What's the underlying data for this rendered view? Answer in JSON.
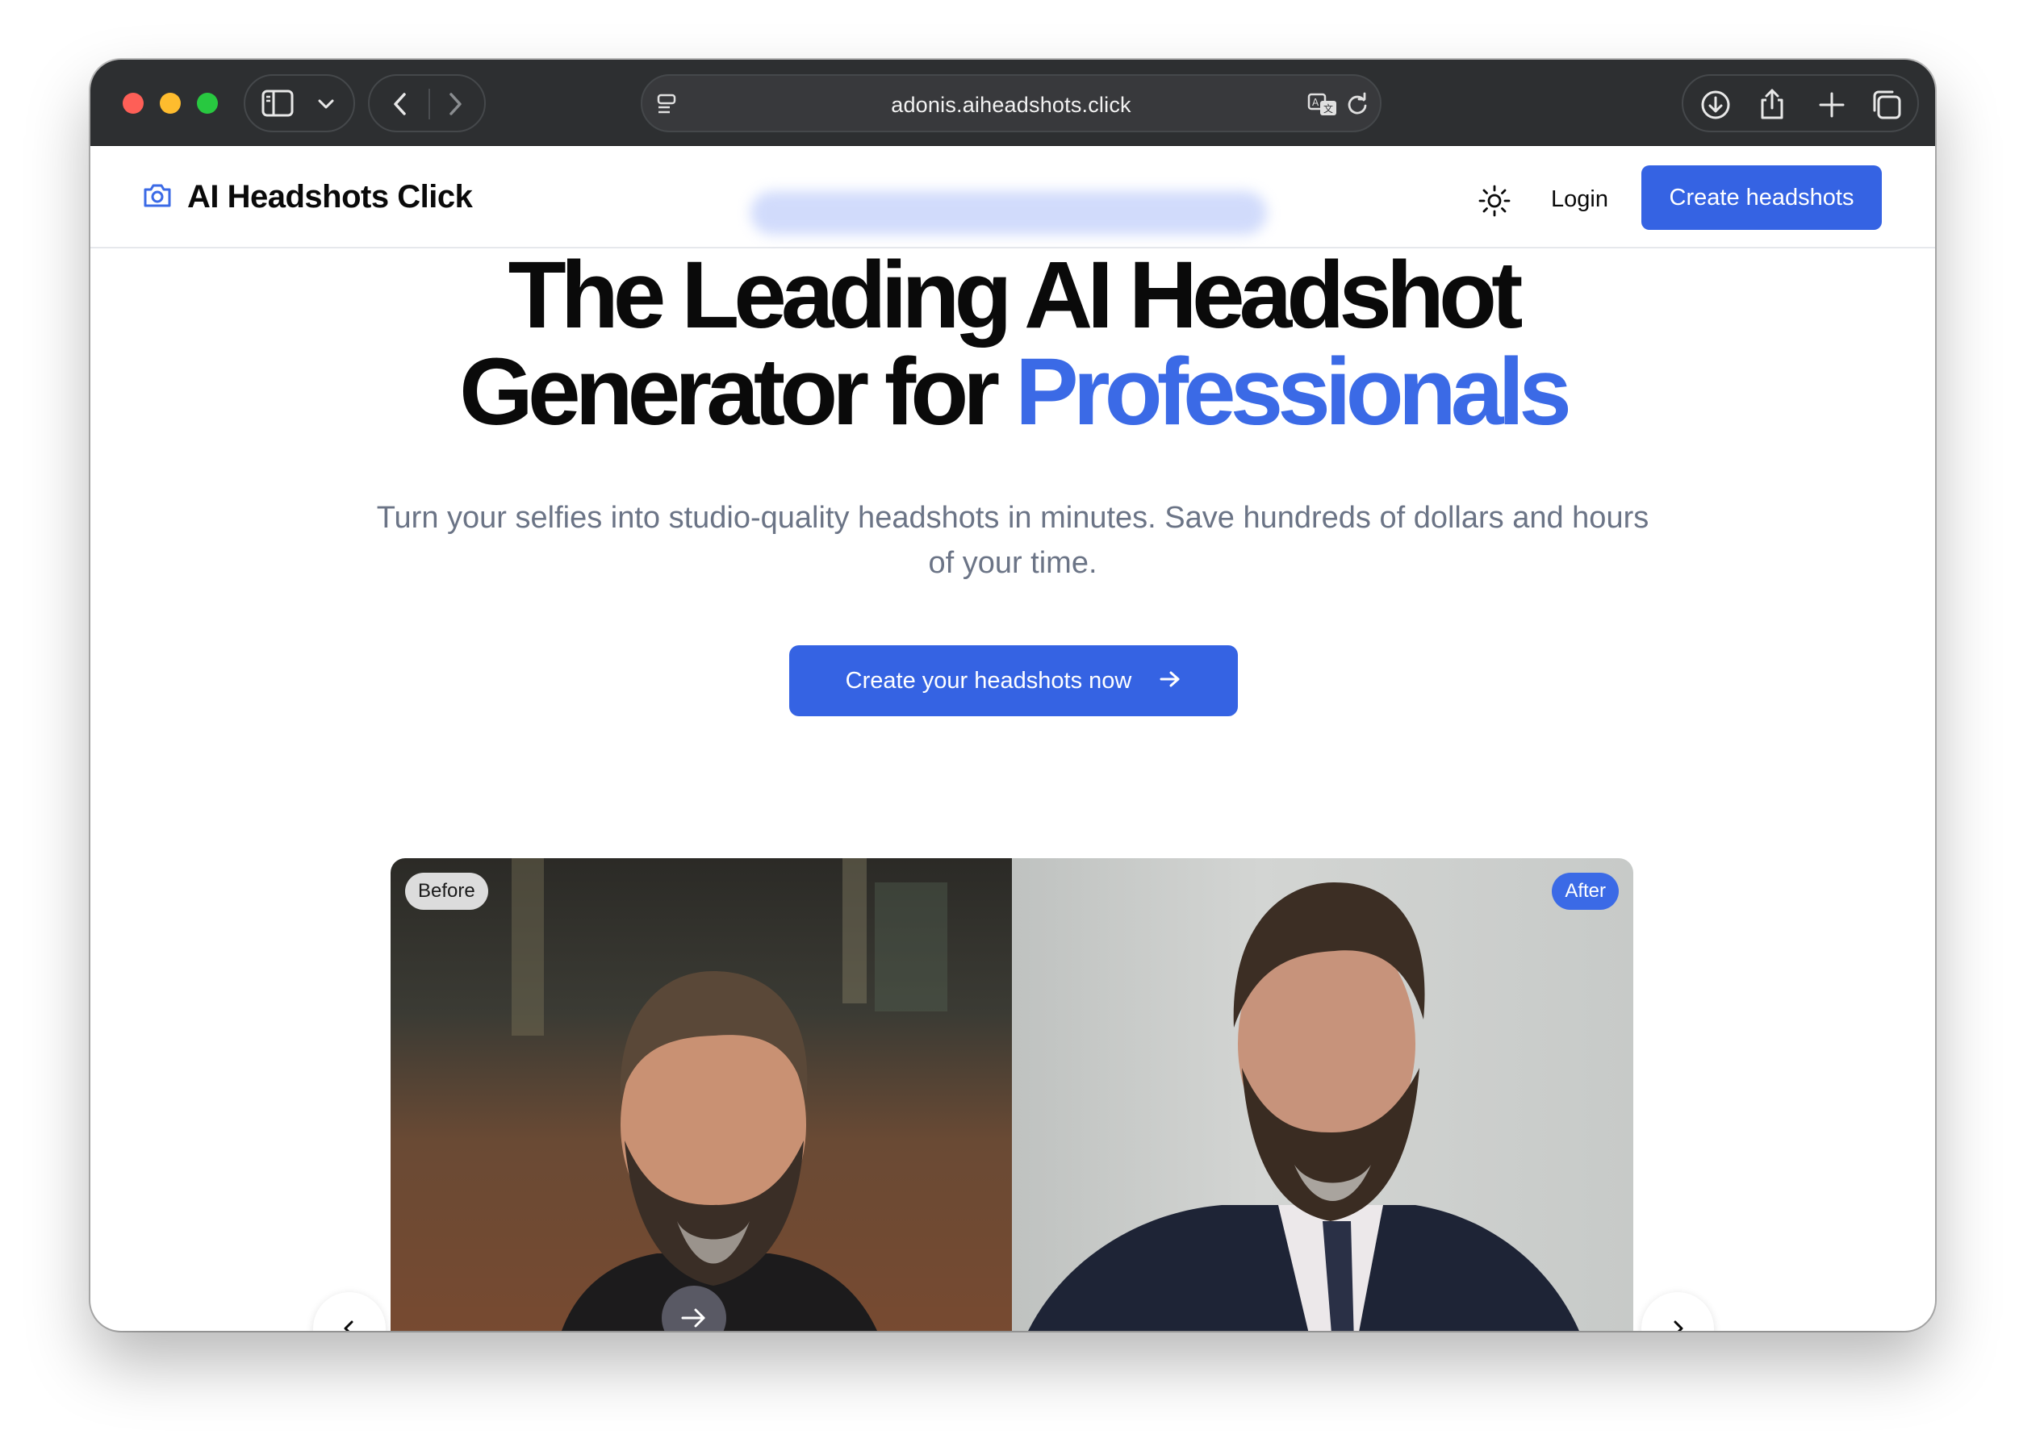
{
  "browser": {
    "url": "adonis.aiheadshots.click"
  },
  "header": {
    "brand_name": "AI Headshots Click",
    "login_label": "Login",
    "create_label": "Create headshots"
  },
  "hero": {
    "title_line1": "The Leading AI Headshot",
    "title_line2_prefix": "Generator for ",
    "title_line2_accent": "Professionals",
    "subtitle": "Turn your selfies into studio-quality headshots in minutes. Save hundreds of dollars and hours of your time.",
    "cta_label": "Create your headshots now"
  },
  "comparison": {
    "before_label": "Before",
    "after_label": "After"
  },
  "colors": {
    "accent": "#3563e3",
    "accent_text": "#3b6ae6",
    "titlebar": "#2d2f31"
  }
}
